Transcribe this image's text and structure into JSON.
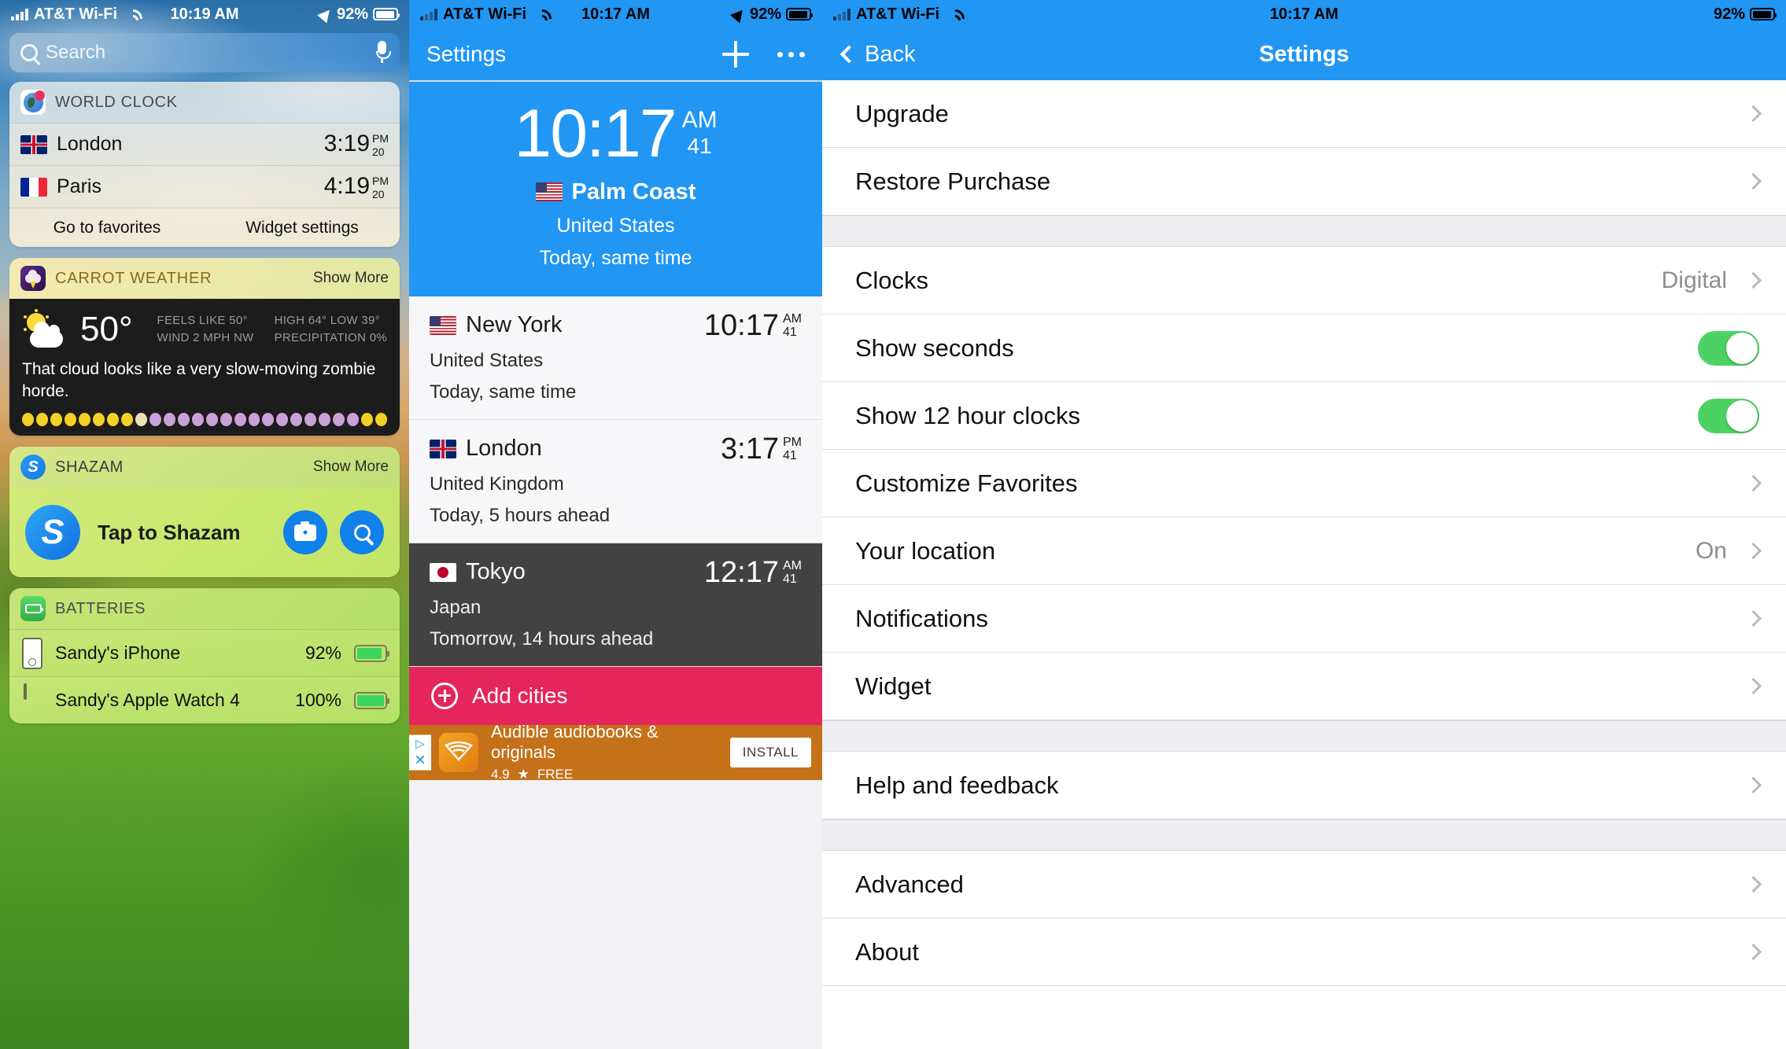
{
  "panel1": {
    "status": {
      "carrier": "AT&T Wi-Fi",
      "time": "10:19 AM",
      "battery": "92%"
    },
    "search": {
      "placeholder": "Search"
    },
    "world_clock": {
      "title": "WORLD CLOCK",
      "rows": [
        {
          "flag": "uk-flag",
          "city": "London",
          "time": "3:19",
          "ampm": "PM",
          "seconds": "20"
        },
        {
          "flag": "fr-flag",
          "city": "Paris",
          "time": "4:19",
          "ampm": "PM",
          "seconds": "20"
        }
      ],
      "footer": {
        "left": "Go to favorites",
        "right": "Widget settings"
      }
    },
    "carrot": {
      "title": "CARROT WEATHER",
      "show_more": "Show More",
      "temp": "50°",
      "stats_left": [
        "FEELS LIKE 50°",
        "WIND 2 MPH NW"
      ],
      "stats_right": [
        "HIGH 64° LOW 39°",
        "PRECIPITATION 0%"
      ],
      "quote": "That cloud looks like a very slow-moving zombie horde.",
      "dot_colors": [
        "#f2d024",
        "#f2d024",
        "#f2d024",
        "#f2d024",
        "#f2d024",
        "#f2d024",
        "#f2d024",
        "#f2d024",
        "#ece0b0",
        "#c9a0d8",
        "#c9a0d8",
        "#c9a0d8",
        "#c9a0d8",
        "#c9a0d8",
        "#c9a0d8",
        "#c9a0d8",
        "#c9a0d8",
        "#c9a0d8",
        "#c9a0d8",
        "#c9a0d8",
        "#c9a0d8",
        "#c9a0d8",
        "#c9a0d8",
        "#c9a0d8",
        "#f2d024",
        "#f2d024"
      ]
    },
    "shazam": {
      "title": "SHAZAM",
      "show_more": "Show More",
      "tap_label": "Tap to Shazam",
      "logo_letter": "S"
    },
    "batteries": {
      "title": "BATTERIES",
      "rows": [
        {
          "device": "phone-icon",
          "name": "Sandy's iPhone",
          "pct": "92%",
          "level": 92
        },
        {
          "device": "watch-icon",
          "name": "Sandy's Apple Watch 4",
          "pct": "100%",
          "level": 100
        }
      ]
    }
  },
  "panel2": {
    "status": {
      "carrier": "AT&T Wi-Fi",
      "time": "10:17 AM",
      "battery": "92%"
    },
    "nav": {
      "title": "Settings"
    },
    "hero": {
      "time": "10:17",
      "ampm": "AM",
      "seconds": "41",
      "city": "Palm Coast",
      "country": "United States",
      "relative": "Today, same time"
    },
    "cities": [
      {
        "flag": "us-flag",
        "name": "New York",
        "time": "10:17",
        "ampm": "AM",
        "seconds": "41",
        "country": "United States",
        "relative": "Today, same time",
        "dark": false
      },
      {
        "flag": "uk-flag",
        "name": "London",
        "time": "3:17",
        "ampm": "PM",
        "seconds": "41",
        "country": "United Kingdom",
        "relative": "Today, 5 hours ahead",
        "dark": false
      },
      {
        "flag": "jp-flag",
        "name": "Tokyo",
        "time": "12:17",
        "ampm": "AM",
        "seconds": "41",
        "country": "Japan",
        "relative": "Tomorrow, 14 hours ahead",
        "dark": true
      }
    ],
    "add_cities": "Add cities",
    "ad": {
      "title": "Audible audiobooks & originals",
      "rating": "4.9",
      "price": "FREE",
      "install": "INSTALL"
    },
    "colors": {
      "accent": "#2196f3",
      "add_cities_bg": "#e4265c",
      "ad_bg": "#c4711a",
      "dark_row": "#424242"
    }
  },
  "panel3": {
    "status": {
      "carrier": "AT&T Wi-Fi",
      "time": "10:17 AM",
      "battery": "92%"
    },
    "nav": {
      "back": "Back",
      "title": "Settings"
    },
    "groups": [
      {
        "rows": [
          {
            "label": "Upgrade",
            "type": "chevron"
          },
          {
            "label": "Restore Purchase",
            "type": "chevron"
          }
        ]
      },
      {
        "rows": [
          {
            "label": "Clocks",
            "type": "value-chevron",
            "value": "Digital"
          },
          {
            "label": "Show seconds",
            "type": "toggle",
            "on": true
          },
          {
            "label": "Show 12 hour clocks",
            "type": "toggle",
            "on": true
          },
          {
            "label": "Customize Favorites",
            "type": "chevron"
          },
          {
            "label": "Your location",
            "type": "value-chevron",
            "value": "On"
          },
          {
            "label": "Notifications",
            "type": "chevron"
          },
          {
            "label": "Widget",
            "type": "chevron"
          }
        ]
      },
      {
        "rows": [
          {
            "label": "Help and feedback",
            "type": "chevron"
          }
        ]
      },
      {
        "rows": [
          {
            "label": "Advanced",
            "type": "chevron"
          },
          {
            "label": "About",
            "type": "chevron"
          }
        ]
      }
    ],
    "colors": {
      "accent": "#2196f3",
      "toggle_on": "#4cd263"
    }
  }
}
